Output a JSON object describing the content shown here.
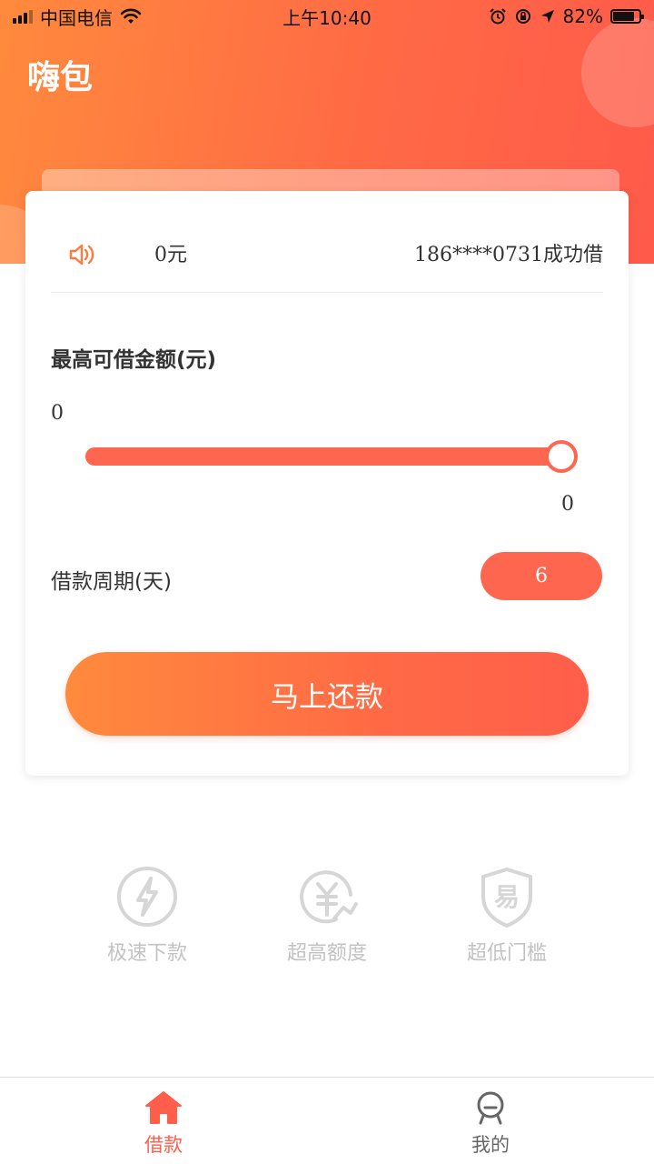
{
  "status_bar": {
    "carrier": "中国电信",
    "time": "上午10:40",
    "battery": "82%",
    "battery_fraction": 0.82
  },
  "header": {
    "app_title": "嗨包"
  },
  "notice": {
    "scroll_left": "0元",
    "scroll_right": "186****0731成功借"
  },
  "loan": {
    "amount_label": "最高可借金额(元)",
    "amount_min": "0",
    "amount_max": "0",
    "slider_fraction": 1.0,
    "period_label": "借款周期(天)",
    "period_value": "6",
    "cta_label": "马上还款"
  },
  "features": [
    {
      "icon": "lightning-icon",
      "label": "极速下款"
    },
    {
      "icon": "yen-growth-icon",
      "label": "超高额度"
    },
    {
      "icon": "shield-yi-icon",
      "label": "超低门槛"
    }
  ],
  "tabbar": {
    "tabs": [
      {
        "icon": "home-icon",
        "label": "借款",
        "active": true
      },
      {
        "icon": "profile-icon",
        "label": "我的",
        "active": false
      }
    ]
  },
  "colors": {
    "accent": "#ff6650",
    "gradient_start": "#ff8a3d",
    "gradient_end": "#ff5a4a",
    "muted_icon": "#d6d6d6"
  }
}
